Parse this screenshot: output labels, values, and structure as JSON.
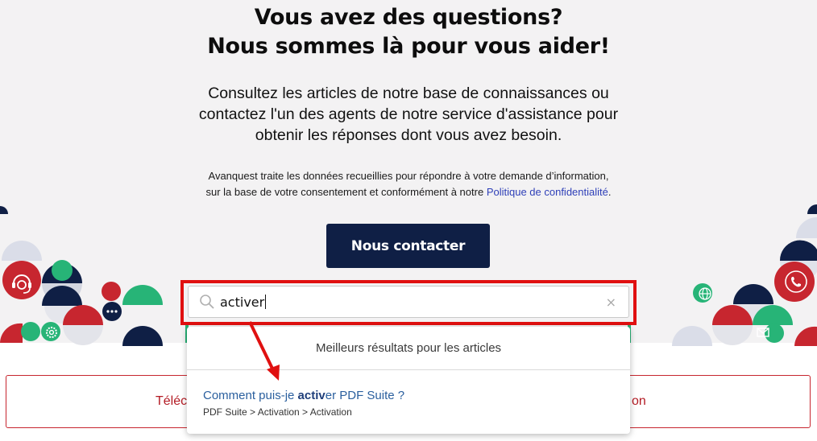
{
  "hero": {
    "title_line1": "Vous avez des questions?",
    "title_line2": "Nous sommes là pour vous aider!",
    "subtitle_line1": "Consultez les articles de notre base de connaissances ou",
    "subtitle_line2": "contactez l'un des agents de notre service d'assistance pour",
    "subtitle_line3": "obtenir les réponses dont vous avez besoin.",
    "legal_line1": "Avanquest traite les données recueillies pour répondre à votre demande d’information,",
    "legal_line2_prefix": "sur la base de votre consentement et conformément à notre ",
    "legal_link": "Politique de confidentialité",
    "legal_line2_suffix": ".",
    "contact_button": "Nous contacter"
  },
  "search": {
    "value": "activer",
    "clear_symbol": "×"
  },
  "dropdown": {
    "header": "Meilleurs résultats pour les articles",
    "result_prefix": "Comment puis-je ",
    "result_highlight": "activ",
    "result_suffix": "er PDF Suite ?",
    "result_path": "PDF Suite > Activation > Activation"
  },
  "banner": {
    "left_text": "Téléc",
    "right_text": "on"
  },
  "icons": {
    "left": [
      "headset-icon",
      "chat-bubble-icon",
      "gear-icon"
    ],
    "right": [
      "phone-icon",
      "globe-icon",
      "mail-icon"
    ],
    "search": "search-icon",
    "annotation": "arrow-icon"
  },
  "colors": {
    "navy": "#0f1f45",
    "red": "#c7262f",
    "green": "#27b477",
    "annotation_red": "#e01010",
    "hero_bg": "#f3f2f3"
  }
}
